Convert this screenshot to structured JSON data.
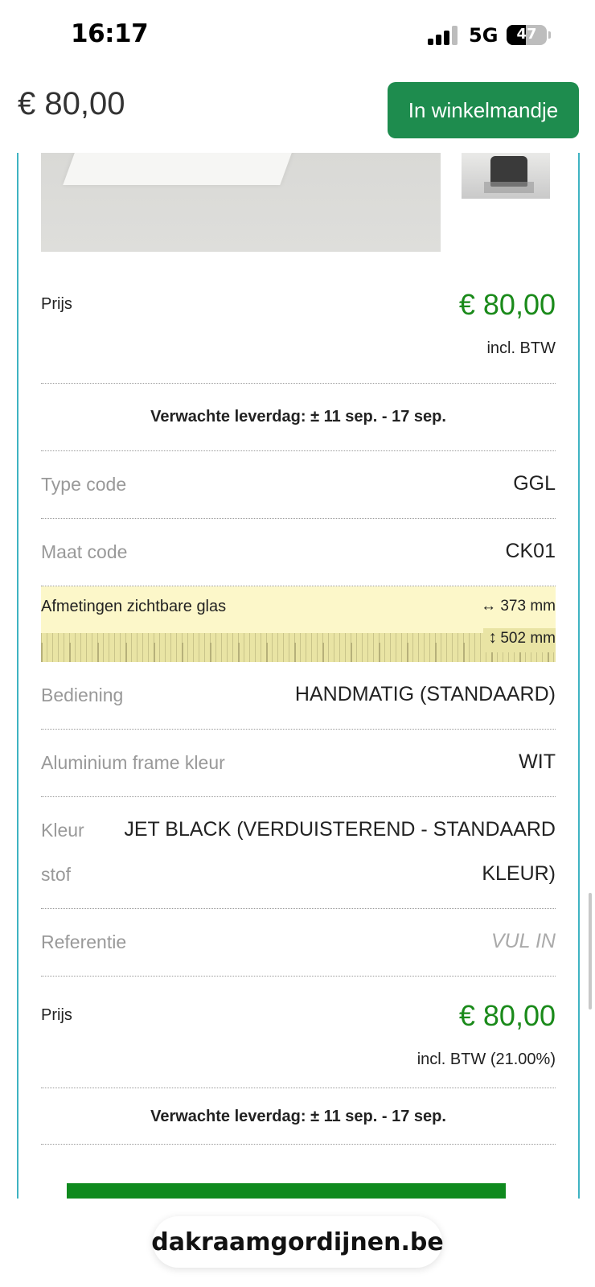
{
  "status": {
    "time": "16:17",
    "network": "5G",
    "battery": "47",
    "battery_level": 0.47
  },
  "header": {
    "price": "€ 80,00",
    "cart_button": "In winkelmandje"
  },
  "price_block": {
    "label": "Prijs",
    "price": "€ 80,00",
    "vat": "incl. BTW"
  },
  "delivery": "Verwachte leverdag: ± 11 sep. - 17 sep.",
  "specs": {
    "type_code": {
      "label": "Type code",
      "value": "GGL"
    },
    "maat_code": {
      "label": "Maat code",
      "value": "CK01"
    },
    "dimensions": {
      "label": "Afmetingen zichtbare glas",
      "width": "373 mm",
      "height": "502 mm"
    },
    "bediening": {
      "label": "Bediening",
      "value": "HANDMATIG (STANDAARD)"
    },
    "frame_kleur": {
      "label": "Aluminium frame kleur",
      "value": "WIT"
    },
    "kleur_stof": {
      "label_line1": "Kleur",
      "label_line2": "stof",
      "value_line1": "JET BLACK (VERDUISTEREND - STANDAARD",
      "value_line2": "KLEUR)"
    },
    "referentie": {
      "label": "Referentie",
      "placeholder": "VUL IN"
    }
  },
  "price_block2": {
    "label": "Prijs",
    "price": "€ 80,00",
    "vat": "incl. BTW (21.00%)"
  },
  "delivery2": "Verwachte leverdag: ± 11 sep. - 17 sep.",
  "browser": {
    "url": "dakraamgordijnen.be"
  },
  "colors": {
    "accent_green": "#1e8c4e",
    "price_green": "#1a8a1a",
    "border_teal": "#3fb3c2",
    "highlight_yellow": "#fcf7c9"
  }
}
